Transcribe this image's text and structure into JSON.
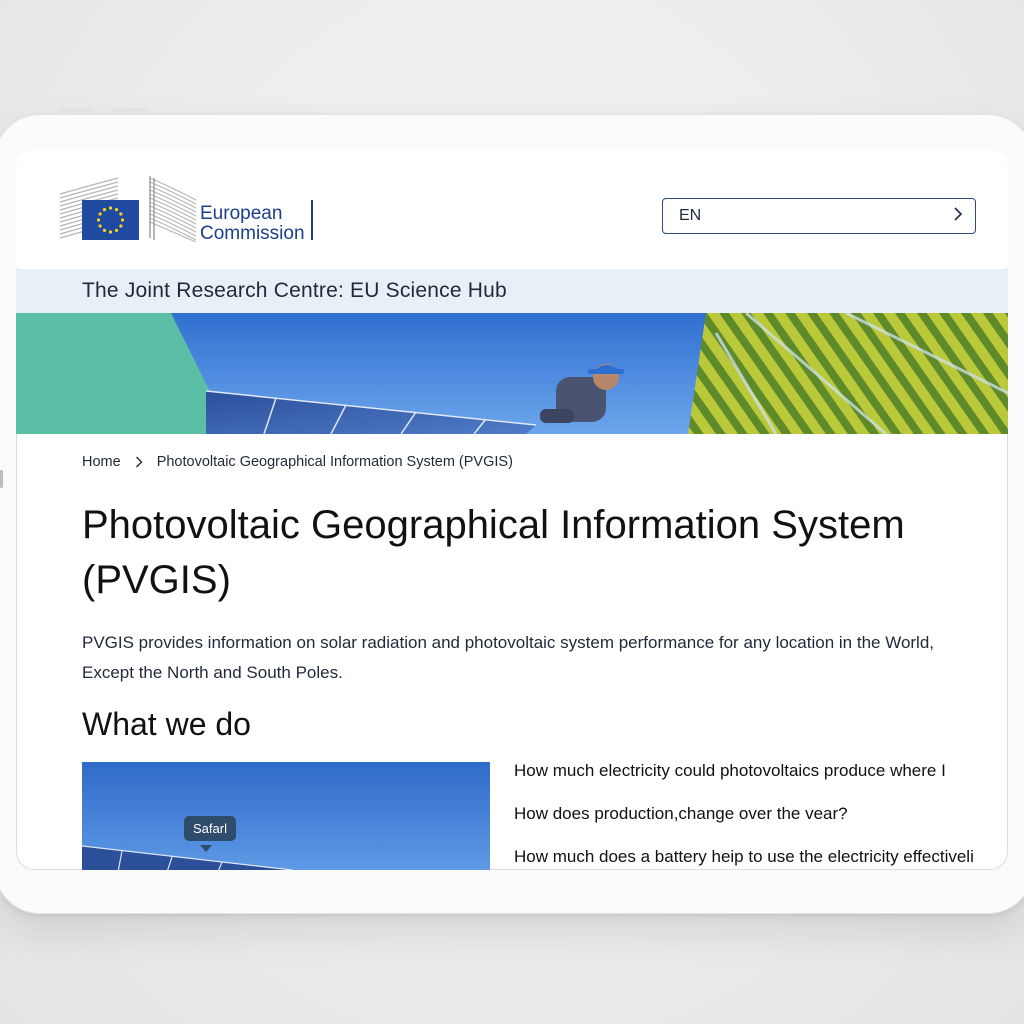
{
  "header": {
    "brand_line1": "European",
    "brand_line2": "Commission",
    "language": "EN"
  },
  "site": {
    "title": "The Joint Research Centre: EU Science Hub"
  },
  "breadcrumb": {
    "home": "Home",
    "current": "Photovoltaic Geographical Information System (PVGIS)"
  },
  "page": {
    "title": "Photovoltaic Geographical Information System (PVGIS)",
    "intro": "PVGIS provides information on solar radiation and photovoltaic system performance for any location in the World, Except the North and South Poles."
  },
  "what_we_do": {
    "heading": "What we do",
    "tooltip": "Safarl",
    "questions": [
      "How much electricity could photovoltaics produce where I",
      "How does production,change over the vear?",
      "How much does a battery heip to use the electricity effectiveli"
    ]
  },
  "colors": {
    "brand_blue": "#1b3f8a",
    "site_bar": "#e9eff7",
    "teal": "#5bbfa6",
    "sky": "#3d7fd8"
  }
}
